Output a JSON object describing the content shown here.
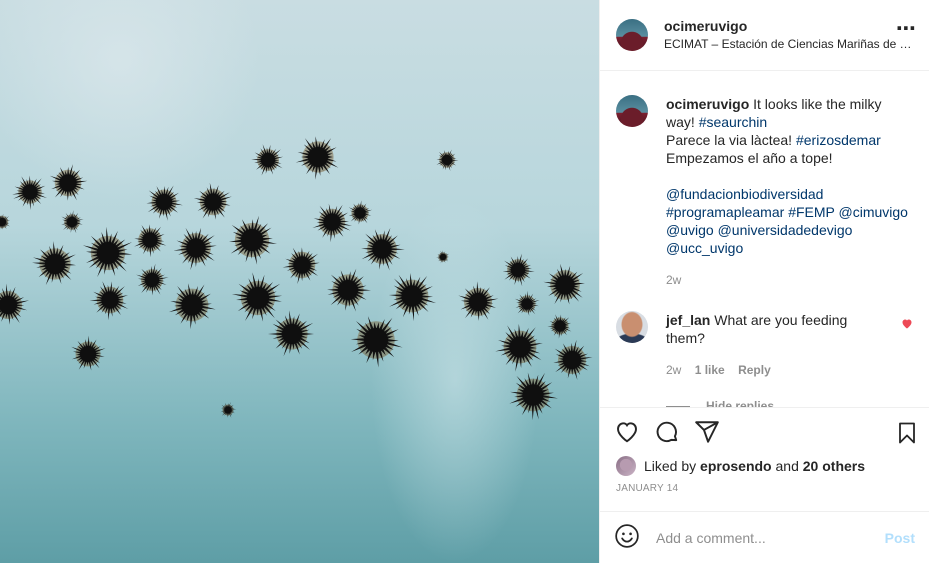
{
  "post": {
    "username": "ocimeruvigo",
    "location": "ECIMAT – Estación de Ciencias Mariñas de Toralla"
  },
  "caption": {
    "username": "ocimeruvigo",
    "line1_text": "It looks like the milky way!",
    "line1_tag": "#seaurchin",
    "line2_text": "Parece la via làctea!",
    "line2_tag": "#erizosdemar",
    "line3": "Empezamos el año a tope!",
    "mention1": "@fundacionbiodiversidad",
    "tag3": "#programapleamar",
    "tag4": "#FEMP",
    "mention2": "@cimuvigo",
    "mention3": "@uvigo",
    "mention4": "@universidadedevigo",
    "mention5": "@ucc_uvigo",
    "age": "2w"
  },
  "comment": {
    "username": "jef_lan",
    "text": "What are you feeding them?",
    "age": "2w",
    "likes": "1 like",
    "reply": "Reply",
    "hide_replies": "Hide replies"
  },
  "likes": {
    "prefix": "Liked by",
    "user": "eprosendo",
    "middle": "and",
    "others": "20 others"
  },
  "date": "JANUARY 14",
  "add_comment": {
    "placeholder": "Add a comment...",
    "post_label": "Post"
  },
  "colors": {
    "heart": "#ed4956",
    "link": "#00376b",
    "post_button": "#b2dffc",
    "muted": "#8e8e8e"
  },
  "icons": [
    "more-icon",
    "heart-icon",
    "comment-icon",
    "share-icon",
    "bookmark-icon",
    "emoji-icon"
  ]
}
